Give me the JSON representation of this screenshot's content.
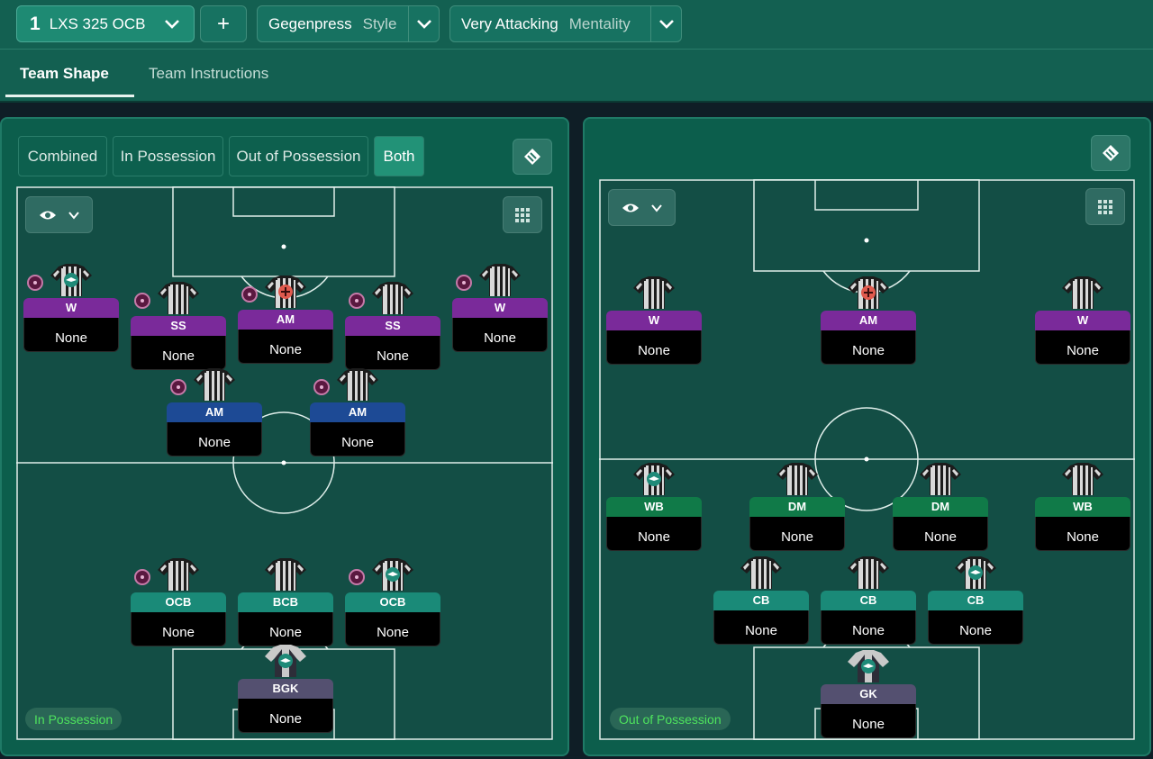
{
  "header": {
    "tactic_number": "1",
    "tactic_name": "LXS 325 OCB",
    "add_label": "+",
    "style_value": "Gegenpress",
    "style_label": "Style",
    "mentality_value": "Very Attacking",
    "mentality_label": "Mentality"
  },
  "tabs": [
    {
      "label": "Team Shape"
    },
    {
      "label": "Team Instructions"
    }
  ],
  "view_toggle": [
    "Combined",
    "In Possession",
    "Out of Possession",
    "Both"
  ],
  "left_pitch": {
    "label": "In Possession",
    "players": [
      {
        "role": "W",
        "duty": "None"
      },
      {
        "role": "SS",
        "duty": "None"
      },
      {
        "role": "AM",
        "duty": "None"
      },
      {
        "role": "SS",
        "duty": "None"
      },
      {
        "role": "W",
        "duty": "None"
      },
      {
        "role": "AM",
        "duty": "None"
      },
      {
        "role": "AM",
        "duty": "None"
      },
      {
        "role": "OCB",
        "duty": "None"
      },
      {
        "role": "BCB",
        "duty": "None"
      },
      {
        "role": "OCB",
        "duty": "None"
      },
      {
        "role": "BGK",
        "duty": "None"
      }
    ]
  },
  "right_pitch": {
    "label": "Out of Possession",
    "players": [
      {
        "role": "W",
        "duty": "None"
      },
      {
        "role": "AM",
        "duty": "None"
      },
      {
        "role": "W",
        "duty": "None"
      },
      {
        "role": "WB",
        "duty": "None"
      },
      {
        "role": "DM",
        "duty": "None"
      },
      {
        "role": "DM",
        "duty": "None"
      },
      {
        "role": "WB",
        "duty": "None"
      },
      {
        "role": "CB",
        "duty": "None"
      },
      {
        "role": "CB",
        "duty": "None"
      },
      {
        "role": "CB",
        "duty": "None"
      },
      {
        "role": "GK",
        "duty": "None"
      }
    ]
  },
  "colors": {
    "attack_role": "#7a2a9a",
    "support_role": "#1d4a95",
    "defence_role": "#1a8a78",
    "defensive_mid_role": "#107a48",
    "keeper_role": "#545070",
    "possession_label": "#4ee35d"
  },
  "icons": [
    "chevron-down-icon",
    "plus-icon",
    "eye-icon",
    "grid-icon",
    "tactic-board-icon",
    "shirt-icon",
    "instruction-badge-icon"
  ]
}
